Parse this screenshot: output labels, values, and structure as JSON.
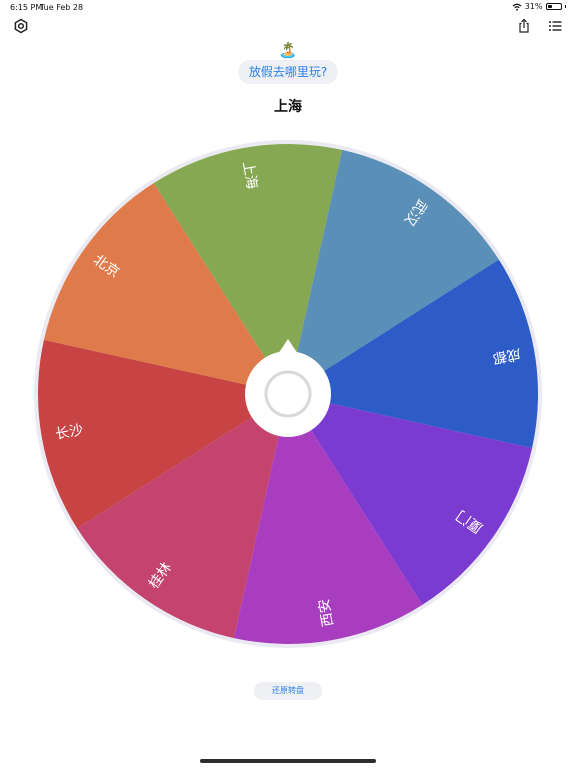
{
  "status_bar": {
    "time": "6:15 PM",
    "date": "Tue Feb 28",
    "battery": "31%",
    "battery_level": 0.31
  },
  "toolbar": {
    "settings_icon": "gear-icon",
    "share_icon": "share-icon",
    "list_icon": "list-icon"
  },
  "header": {
    "emoji": "🏝️",
    "title": "放假去哪里玩?",
    "result": "上海"
  },
  "wheel": {
    "segments": [
      {
        "label": "上海",
        "color": "#87a852"
      },
      {
        "label": "武汉",
        "color": "#5a8fb8"
      },
      {
        "label": "成都",
        "color": "#2d5bc7"
      },
      {
        "label": "厦门",
        "color": "#7b3bd0"
      },
      {
        "label": "西安",
        "color": "#a83dc0"
      },
      {
        "label": "桂林",
        "color": "#c4446f"
      },
      {
        "label": "长沙",
        "color": "#c84343"
      },
      {
        "label": "北京",
        "color": "#df7b4b"
      }
    ],
    "rim_color": "#ebeaf2",
    "hub_color": "#ffffff",
    "hub_ring_color": "#d9d9d9"
  },
  "footer": {
    "reset_label": "还原转盘"
  }
}
